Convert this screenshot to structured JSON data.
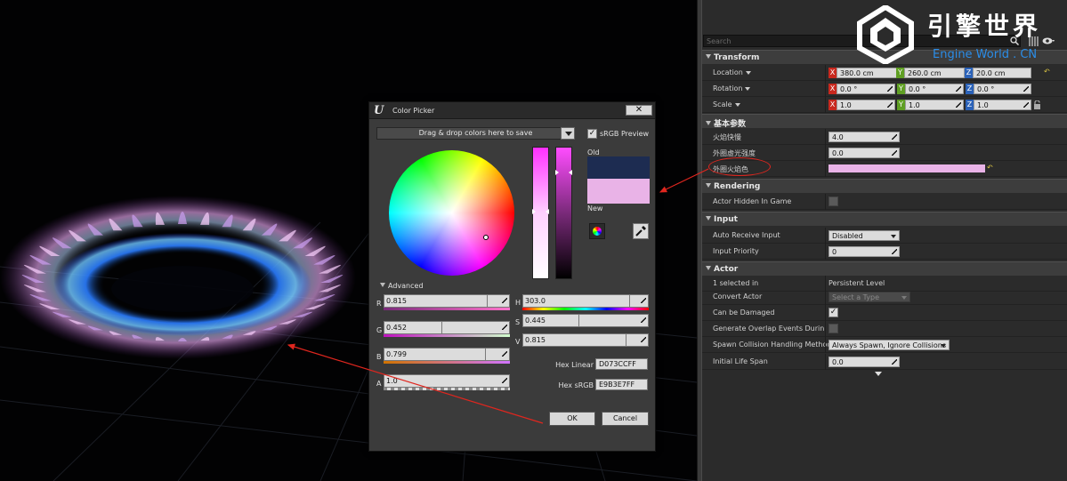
{
  "search": {
    "placeholder": "Search"
  },
  "logo": {
    "cn": "引擎世界",
    "en": "Engine World . CN"
  },
  "details": {
    "transform": {
      "title": "Transform",
      "location": {
        "label": "Location",
        "x": "380.0 cm",
        "y": "260.0 cm",
        "z": "20.0 cm"
      },
      "rotation": {
        "label": "Rotation",
        "x": "0.0 °",
        "y": "0.0 °",
        "z": "0.0 °"
      },
      "scale": {
        "label": "Scale",
        "x": "1.0",
        "y": "1.0",
        "z": "1.0"
      },
      "axis": {
        "x": "X",
        "y": "Y",
        "z": "Z"
      }
    },
    "basic": {
      "title": "基本参数",
      "flame_speed": {
        "label": "火焰快慢",
        "value": "4.0"
      },
      "outer_glow": {
        "label": "外圈虚光强度",
        "value": "0.0"
      },
      "outer_color": {
        "label": "外圈火焰色",
        "value_hex": "#e9b3e7"
      }
    },
    "rendering": {
      "title": "Rendering",
      "actor_hidden": {
        "label": "Actor Hidden In Game",
        "checked": false
      }
    },
    "input": {
      "title": "Input",
      "auto_receive": {
        "label": "Auto Receive Input",
        "value": "Disabled"
      },
      "priority": {
        "label": "Input Priority",
        "value": "0"
      }
    },
    "actor": {
      "title": "Actor",
      "selected": {
        "label": "1 selected in",
        "value": "Persistent Level"
      },
      "convert": {
        "label": "Convert Actor",
        "value": "Select a Type"
      },
      "damaged": {
        "label": "Can be Damaged",
        "checked": true
      },
      "overlap": {
        "label": "Generate Overlap Events During Le",
        "checked": false
      },
      "spawn": {
        "label": "Spawn Collision Handling Method",
        "value": "Always Spawn, Ignore Collisions"
      },
      "lifespan": {
        "label": "Initial Life Span",
        "value": "0.0"
      }
    }
  },
  "picker": {
    "title": "Color Picker",
    "close": "✕",
    "drop_text": "Drag & drop colors here to save",
    "srgb_label": "sRGB Preview",
    "srgb_checked": true,
    "old_label": "Old",
    "new_label": "New",
    "old_color": "#1d2c51",
    "new_color": "#e9b3e7",
    "advanced": "Advanced",
    "r": {
      "label": "R",
      "value": "0.815"
    },
    "g": {
      "label": "G",
      "value": "0.452"
    },
    "b": {
      "label": "B",
      "value": "0.799"
    },
    "a": {
      "label": "A",
      "value": "1.0"
    },
    "h": {
      "label": "H",
      "value": "303.0"
    },
    "s": {
      "label": "S",
      "value": "0.445"
    },
    "v": {
      "label": "V",
      "value": "0.815"
    },
    "hex_linear": {
      "label": "Hex Linear",
      "value": "D073CCFF"
    },
    "hex_srgb": {
      "label": "Hex sRGB",
      "value": "E9B3E7FF"
    },
    "ok": "OK",
    "cancel": "Cancel"
  },
  "colors": {
    "accent_red": "#e0261e",
    "panel": "#2b2b2b"
  }
}
